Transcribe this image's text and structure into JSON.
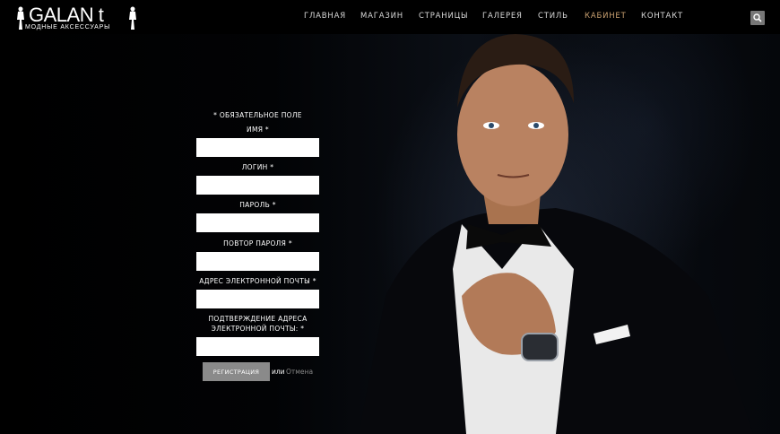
{
  "brand": {
    "name": "GALAN t",
    "tagline": "МОДНЫЕ АКСЕССУАРЫ"
  },
  "nav": {
    "items": [
      {
        "label": "ГЛАВНАЯ"
      },
      {
        "label": "МАГАЗИН"
      },
      {
        "label": "СТРАНИЦЫ"
      },
      {
        "label": "ГАЛЕРЕЯ"
      },
      {
        "label": "СТИЛЬ"
      },
      {
        "label": "КАБИНЕТ",
        "active": true
      },
      {
        "label": "КОНТАКТ"
      }
    ],
    "search_icon": "search-icon"
  },
  "form": {
    "required_note": "* ОБЯЗАТЕЛЬНОЕ ПОЛЕ",
    "fields": [
      {
        "label": "ИМЯ *",
        "value": ""
      },
      {
        "label": "ЛОГИН *",
        "value": ""
      },
      {
        "label": "ПАРОЛЬ *",
        "value": ""
      },
      {
        "label": "ПОВТОР ПАРОЛЯ *",
        "value": ""
      },
      {
        "label": "АДРЕС ЭЛЕКТРОННОЙ ПОЧТЫ *",
        "value": ""
      },
      {
        "label": "ПОДТВЕРЖДЕНИЕ АДРЕСА ЭЛЕКТРОННОЙ ПОЧТЫ: *",
        "value": ""
      }
    ],
    "submit_label": "РЕГИСТРАЦИЯ",
    "or_text": "или",
    "cancel_label": "Отмена"
  },
  "colors": {
    "active_nav": "#c9a070",
    "submit_bg": "#8a8a8a",
    "cancel_link": "#888888"
  }
}
